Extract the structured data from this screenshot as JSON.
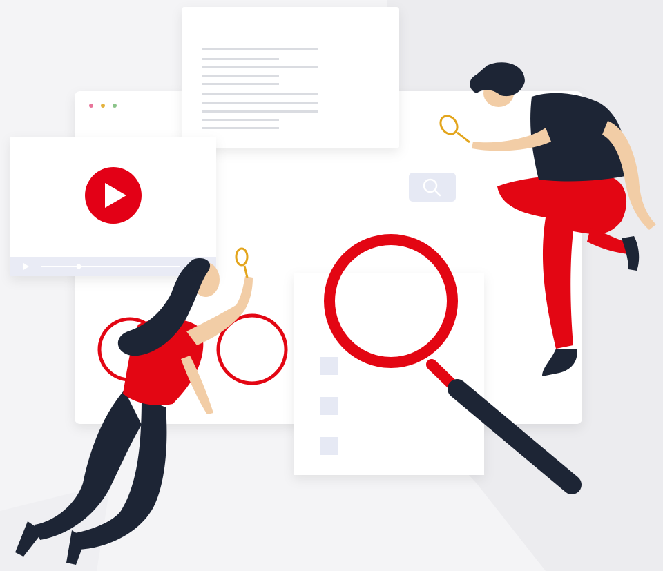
{
  "illustration": {
    "subject": "search-and-research-scene",
    "colors": {
      "accent": "#e30613",
      "navy": "#1d2535",
      "skin": "#f2cda6",
      "gold": "#e3a51c",
      "panel": "#ffffff",
      "panel_shade": "#e9ebf3",
      "line": "#d7d9de",
      "background": "#f4f4f6"
    },
    "icons": [
      "play-icon",
      "search-icon",
      "magnifier-icon",
      "window-dot-icon",
      "checkbox-icon"
    ]
  }
}
